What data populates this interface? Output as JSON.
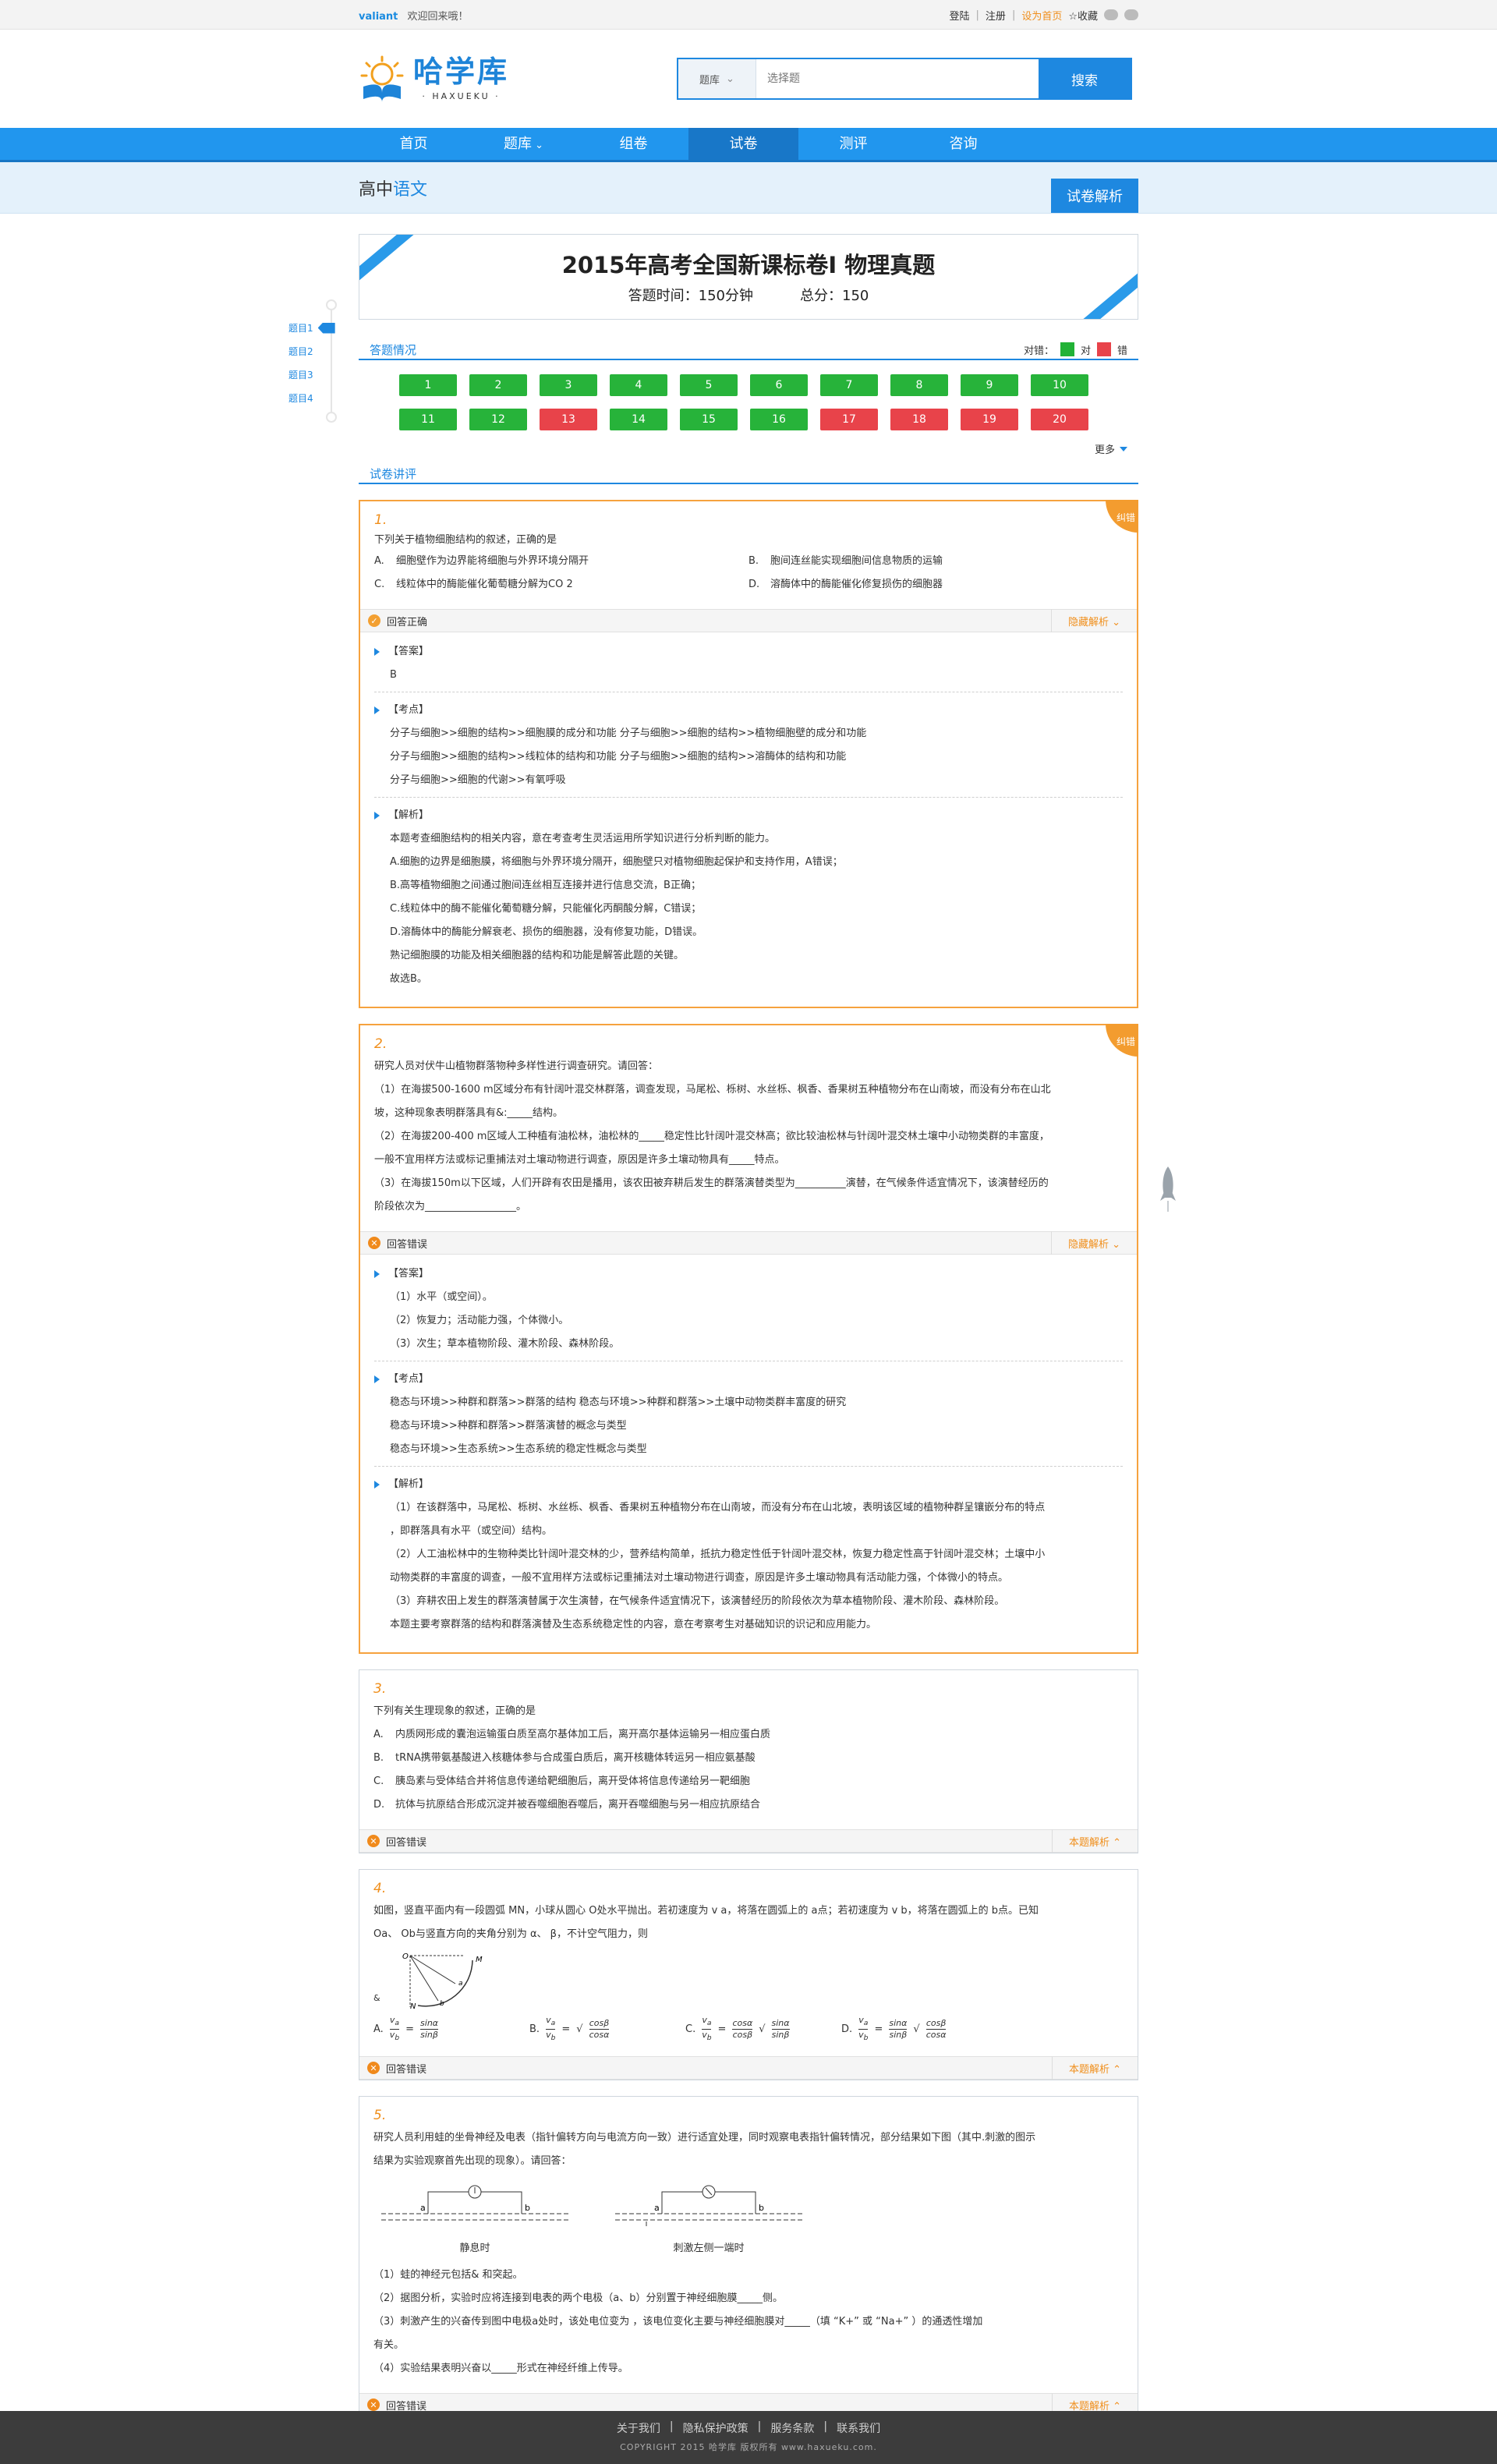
{
  "topbar": {
    "user": "valiant",
    "welcome": "欢迎回来哦！",
    "login": "登陆",
    "register": "注册",
    "set_home": "设为首页",
    "favorite": "☆收藏"
  },
  "logo": {
    "cn": "哈学库",
    "en": "· HAXUEKU ·"
  },
  "search": {
    "category": "题库",
    "placeholder": "选择题",
    "button": "搜索"
  },
  "nav": [
    "首页",
    "题库",
    "组卷",
    "试卷",
    "测评",
    "咨询"
  ],
  "subhead": {
    "prefix": "高中",
    "subject": "语文",
    "analysis_button": "试卷解析"
  },
  "exam": {
    "title": "2015年高考全国新课标卷Ⅰ 物理真题",
    "time": "答题时间：150分钟",
    "score": "总分：150"
  },
  "sidebar": [
    "题目1",
    "题目2",
    "题目3",
    "题目4"
  ],
  "answer_section": {
    "title": "答题情况",
    "legend_label": "对错：",
    "legend_right": "对",
    "legend_wrong": "错",
    "more": "更多",
    "cells": [
      {
        "n": "1",
        "s": "g"
      },
      {
        "n": "2",
        "s": "g"
      },
      {
        "n": "3",
        "s": "g"
      },
      {
        "n": "4",
        "s": "g"
      },
      {
        "n": "5",
        "s": "g"
      },
      {
        "n": "6",
        "s": "g"
      },
      {
        "n": "7",
        "s": "g"
      },
      {
        "n": "8",
        "s": "g"
      },
      {
        "n": "9",
        "s": "g"
      },
      {
        "n": "10",
        "s": "g"
      },
      {
        "n": "11",
        "s": "g"
      },
      {
        "n": "12",
        "s": "g"
      },
      {
        "n": "13",
        "s": "r"
      },
      {
        "n": "14",
        "s": "g"
      },
      {
        "n": "15",
        "s": "g"
      },
      {
        "n": "16",
        "s": "g"
      },
      {
        "n": "17",
        "s": "r"
      },
      {
        "n": "18",
        "s": "r"
      },
      {
        "n": "19",
        "s": "r"
      },
      {
        "n": "20",
        "s": "r"
      }
    ]
  },
  "lecture_title": "试卷讲评",
  "badge": "纠错",
  "q1": {
    "num": "1.",
    "stem": "下列关于植物细胞结构的叙述，正确的是",
    "options": [
      {
        "k": "A.",
        "t": "细胞壁作为边界能将细胞与外界环境分隔开"
      },
      {
        "k": "B.",
        "t": "胞间连丝能实现细胞间信息物质的运输"
      },
      {
        "k": "C.",
        "t": "线粒体中的酶能催化葡萄糖分解为CO 2"
      },
      {
        "k": "D.",
        "t": "溶酶体中的酶能催化修复损伤的细胞器"
      }
    ],
    "status": "回答正确",
    "toggle": "隐藏解析 ⌄",
    "answer_head": "【答案】",
    "answer": "B",
    "point_head": "【考点】",
    "points": [
      "分子与细胞>>细胞的结构>>细胞膜的成分和功能  分子与细胞>>细胞的结构>>植物细胞壁的成分和功能",
      "分子与细胞>>细胞的结构>>线粒体的结构和功能  分子与细胞>>细胞的结构>>溶酶体的结构和功能",
      "分子与细胞>>细胞的代谢>>有氧呼吸"
    ],
    "analysis_head": "【解析】",
    "analysis": [
      "本题考查细胞结构的相关内容，意在考查考生灵活运用所学知识进行分析判断的能力。",
      "A.细胞的边界是细胞膜，将细胞与外界环境分隔开，细胞壁只对植物细胞起保护和支持作用，A错误；",
      "B.高等植物细胞之间通过胞间连丝相互连接并进行信息交流，B正确；",
      "C.线粒体中的酶不能催化葡萄糖分解，只能催化丙酮酸分解，C错误；",
      "D.溶酶体中的酶能分解衰老、损伤的细胞器，没有修复功能，D错误。",
      "熟记细胞膜的功能及相关细胞器的结构和功能是解答此题的关键。",
      "故选B。"
    ]
  },
  "q2": {
    "num": "2.",
    "stem": [
      "研究人员对伏牛山植物群落物种多样性进行调查研究。请回答：",
      "（1）在海拔500-1600 m区域分布有针阔叶混交林群落，调查发现，马尾松、栎树、水丝栎、枫香、香果树五种植物分布在山南坡，而没有分布在山北",
      "坡，这种现象表明群落具有&:_____结构。",
      "（2）在海拔200-400 m区域人工种植有油松林，油松林的_____稳定性比针阔叶混交林高；欲比较油松林与针阔叶混交林土壤中小动物类群的丰富度，",
      "一般不宜用样方法或标记重捕法对土壤动物进行调查，原因是许多土壤动物具有_____特点。",
      "（3）在海拔150m以下区域，人们开辟有农田是播用，该农田被弃耕后发生的群落演替类型为__________演替，在气候条件适宜情况下，该演替经历的",
      "阶段依次为__________________。"
    ],
    "status": "回答错误",
    "toggle": "隐藏解析 ⌄",
    "answer_head": "【答案】",
    "answers": [
      "（1）水平（或空间）。",
      "（2）恢复力；活动能力强，个体微小。",
      "（3）次生；草本植物阶段、灌木阶段、森林阶段。"
    ],
    "point_head": "【考点】",
    "points": [
      "稳态与环境>>种群和群落>>群落的结构  稳态与环境>>种群和群落>>土壤中动物类群丰富度的研究",
      "稳态与环境>>种群和群落>>群落演替的概念与类型",
      "稳态与环境>>生态系统>>生态系统的稳定性概念与类型"
    ],
    "analysis_head": "【解析】",
    "analysis": [
      "（1）在该群落中，马尾松、栎树、水丝栎、枫香、香果树五种植物分布在山南坡，而没有分布在山北坡，表明该区域的植物种群呈镶嵌分布的特点",
      "，即群落具有水平（或空间）结构。",
      "（2）人工油松林中的生物种类比针阔叶混交林的少，营养结构简单，抵抗力稳定性低于针阔叶混交林，恢复力稳定性高于针阔叶混交林；土壤中小",
      "动物类群的丰富度的调查，一般不宜用样方法或标记重捕法对土壤动物进行调查，原因是许多土壤动物具有活动能力强，个体微小的特点。",
      "（3）弃耕农田上发生的群落演替属于次生演替，在气候条件适宜情况下，该演替经历的阶段依次为草本植物阶段、灌木阶段、森林阶段。",
      "本题主要考察群落的结构和群落演替及生态系统稳定性的内容，意在考察考生对基础知识的识记和应用能力。"
    ]
  },
  "q3": {
    "num": "3.",
    "stem": "下列有关生理现象的叙述，正确的是",
    "options": [
      {
        "k": "A.",
        "t": "内质网形成的囊泡运输蛋白质至高尔基体加工后，离开高尔基体运输另一相应蛋白质"
      },
      {
        "k": "B.",
        "t": "tRNA携带氨基酸进入核糖体参与合成蛋白质后，离开核糖体转运另一相应氨基酸"
      },
      {
        "k": "C.",
        "t": "胰岛素与受体结合并将信息传递给靶细胞后，离开受体将信息传递给另一靶细胞"
      },
      {
        "k": "D.",
        "t": "抗体与抗原结合形成沉淀并被吞噬细胞吞噬后，离开吞噬细胞与另一相应抗原结合"
      }
    ],
    "status": "回答错误",
    "toggle": "本题解析 ⌃"
  },
  "q4": {
    "num": "4.",
    "stem": [
      "如图，竖直平面内有一段圆弧 MN，小球从圆心 O处水平抛出。若初速度为 v a，将落在圆弧上的 a点；若初速度为 v b，将落在圆弧上的 b点。已知",
      "Oa、 Ob与竖直方向的夹角分别为 α、 β，不计空气阻力，则"
    ],
    "fig_label": "&",
    "options": [
      "A.",
      "B.",
      "C.",
      "D."
    ],
    "status": "回答错误",
    "toggle": "本题解析 ⌃"
  },
  "q5": {
    "num": "5.",
    "stem": [
      "研究人员利用蛙的坐骨神经及电表（指针偏转方向与电流方向一致）进行适宜处理，同时观察电表指针偏转情况，部分结果如下图（其中.刺激的图示",
      "结果为实验观察首先出现的现象）。请回答："
    ],
    "fig_labels": [
      "静息时",
      "刺激左侧一端时"
    ],
    "parts": [
      "（1）蛙的神经元包括&           和突起。",
      "（2）据图分析，实验时应将连接到电表的两个电极（a、b）分别置于神经细胞膜_____侧。",
      "（3）刺激产生的兴奋传到图中电极a处时，该处电位变为                ，该电位变化主要与神经细胞膜对_____（填 “K+” 或 “Na+” ）的通透性增加",
      "有关。",
      "（4）实验结果表明兴奋以_____形式在神经纤维上传导。"
    ],
    "status": "回答错误",
    "toggle": "本题解析 ⌃"
  },
  "footer": {
    "links": [
      "关于我们",
      "|",
      "隐私保护政策",
      "|",
      "服务条款",
      "|",
      "联系我们"
    ],
    "copyright": "COPYRIGHT 2015  哈学库  版权所有  www.haxueku.com."
  },
  "colors": {
    "primary": "#1e88e0",
    "nav": "#2196ee",
    "orange": "#f08f1c",
    "green": "#27b33a",
    "red": "#e8434a"
  }
}
